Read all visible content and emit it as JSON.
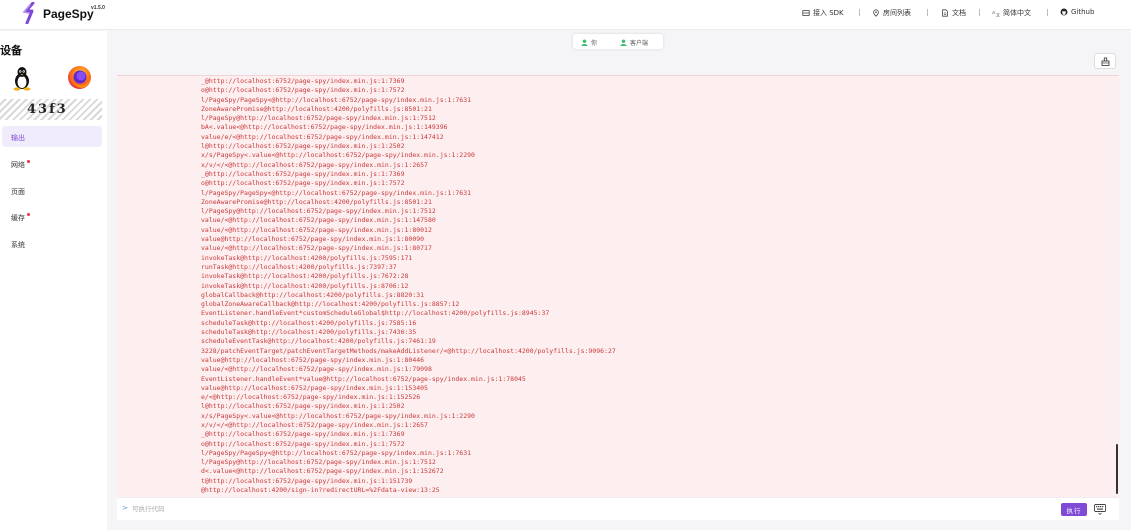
{
  "brand": {
    "name": "PageSpy",
    "version": "v1.5.0",
    "accent": "#7e4ad6"
  },
  "header_nav": [
    {
      "label": "接入 SDK",
      "icon": "plug-icon"
    },
    {
      "label": "房间列表",
      "icon": "location-icon"
    },
    {
      "label": "文档",
      "icon": "document-icon"
    },
    {
      "label": "简体中文",
      "icon": "translate-icon"
    },
    {
      "label": "Github",
      "icon": "github-icon"
    }
  ],
  "sidebar": {
    "title": "设备",
    "os_icon": "linux-icon",
    "browser_icon": "firefox-icon",
    "device_code": "43f3",
    "items": [
      {
        "label": "输出",
        "active": true,
        "dot": false
      },
      {
        "label": "网络",
        "active": false,
        "dot": true
      },
      {
        "label": "页面",
        "active": false,
        "dot": false
      },
      {
        "label": "缓存",
        "active": false,
        "dot": true
      },
      {
        "label": "系统",
        "active": false,
        "dot": false
      }
    ]
  },
  "tabs": [
    {
      "label": "你",
      "icon": "user-icon"
    },
    {
      "label": "客户端",
      "icon": "user-icon"
    }
  ],
  "console": {
    "lines": [
      "_@http://localhost:6752/page-spy/index.min.js:1:7369",
      "o@http://localhost:6752/page-spy/index.min.js:1:7572",
      "l/PageSpy/PageSpy<@http://localhost:6752/page-spy/index.min.js:1:7631",
      "ZoneAwarePromise@http://localhost:4200/polyfills.js:8501:21",
      "l/PageSpy@http://localhost:6752/page-spy/index.min.js:1:7512",
      "bA<.value<@http://localhost:6752/page-spy/index.min.js:1:149396",
      "value/e/<@http://localhost:6752/page-spy/index.min.js:1:147412",
      "l@http://localhost:6752/page-spy/index.min.js:1:2502",
      "x/s/PageSpy<.value<@http://localhost:6752/page-spy/index.min.js:1:2290",
      "x/v/</<@http://localhost:6752/page-spy/index.min.js:1:2657",
      "_@http://localhost:6752/page-spy/index.min.js:1:7369",
      "o@http://localhost:6752/page-spy/index.min.js:1:7572",
      "l/PageSpy/PageSpy<@http://localhost:6752/page-spy/index.min.js:1:7631",
      "ZoneAwarePromise@http://localhost:4200/polyfills.js:8501:21",
      "l/PageSpy@http://localhost:6752/page-spy/index.min.js:1:7512",
      "value/<@http://localhost:6752/page-spy/index.min.js:1:147580",
      "value/<@http://localhost:6752/page-spy/index.min.js:1:80012",
      "value@http://localhost:6752/page-spy/index.min.js:1:80090",
      "value/<@http://localhost:6752/page-spy/index.min.js:1:80717",
      "invokeTask@http://localhost:4200/polyfills.js:7595:171",
      "runTask@http://localhost:4200/polyfills.js:7397:37",
      "invokeTask@http://localhost:4200/polyfills.js:7672:28",
      "invokeTask@http://localhost:4200/polyfills.js:8706:12",
      "globalCallback@http://localhost:4200/polyfills.js:8820:31",
      "globalZoneAwareCallback@http://localhost:4200/polyfills.js:8857:12",
      "EventListener.handleEvent*customScheduleGlobal$http://localhost:4200/polyfills.js:8945:37",
      "scheduleTask@http://localhost:4200/polyfills.js:7585:16",
      "scheduleTask@http://localhost:4200/polyfills.js:7436:35",
      "scheduleEventTask@http://localhost:4200/polyfills.js:7461:19",
      "3228/patchEventTarget/patchEventTargetMethods/makeAddListener/<@http://localhost:4200/polyfills.js:9096:27",
      "value@http://localhost:6752/page-spy/index.min.js:1:80446",
      "value/<@http://localhost:6752/page-spy/index.min.js:1:79098",
      "EventListener.handleEvent*value@http://localhost:6752/page-spy/index.min.js:1:78045",
      "value@http://localhost:6752/page-spy/index.min.js:1:153405",
      "e/<@http://localhost:6752/page-spy/index.min.js:1:152526",
      "l@http://localhost:6752/page-spy/index.min.js:1:2502",
      "x/s/PageSpy<.value<@http://localhost:6752/page-spy/index.min.js:1:2290",
      "x/v/</<@http://localhost:6752/page-spy/index.min.js:1:2657",
      "_@http://localhost:6752/page-spy/index.min.js:1:7369",
      "o@http://localhost:6752/page-spy/index.min.js:1:7572",
      "l/PageSpy/PageSpy<@http://localhost:6752/page-spy/index.min.js:1:7631",
      "l/PageSpy@http://localhost:6752/page-spy/index.min.js:1:7512",
      "d<.value<@http://localhost:6752/page-spy/index.min.js:1:152672",
      "t@http://localhost:6752/page-spy/index.min.js:1:151739",
      "@http://localhost:4200/sign-in?redirectURL=%2Fdata-view:13:25"
    ]
  },
  "input": {
    "prompt": ">",
    "placeholder": "可执行代码",
    "run_label": "执行"
  }
}
